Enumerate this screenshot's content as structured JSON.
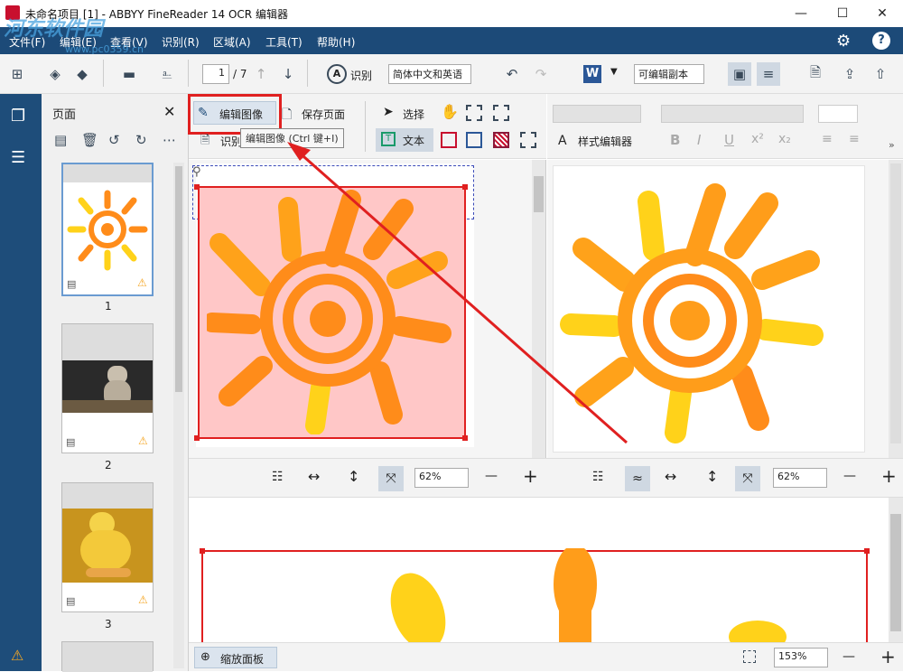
{
  "window": {
    "title": "未命名项目 [1] - ABBYY FineReader 14 OCR 编辑器",
    "minimize": "—",
    "maximize": "☐",
    "close": "✕"
  },
  "watermark": {
    "text": "河东软件园",
    "url": "www.pc0359.cn"
  },
  "menu": {
    "items": [
      "文件(F)",
      "编辑(E)",
      "查看(V)",
      "识别(R)",
      "区域(A)",
      "工具(T)",
      "帮助(H)"
    ],
    "settings_icon": "gear-icon",
    "help_icon": "help-icon"
  },
  "toolbar": {
    "page_current": "1",
    "page_total": "/ 7",
    "recognize_label": "识别",
    "language": "简体中文和英语",
    "output_mode": "可编辑副本"
  },
  "sidebar": {
    "panel_title": "页面",
    "pages": [
      "1",
      "2",
      "3"
    ]
  },
  "edit_toolbar": {
    "edit_image": "编辑图像",
    "save_page": "保存页面",
    "recognize_page": "识别",
    "select": "选择",
    "text": "文本",
    "tooltip": "编辑图像 (Ctrl 键+I)"
  },
  "format_toolbar": {
    "style_editor": "样式编辑器",
    "bold": "B",
    "italic": "I",
    "underline": "U",
    "superscript": "x²",
    "subscript": "x₂"
  },
  "zoom": {
    "image_zoom": "62%",
    "text_zoom": "62%",
    "bottom_zoom": "153%",
    "zoom_panel_label": "缩放面板",
    "minus": "—",
    "plus": "+"
  },
  "colors": {
    "menubar": "#1c4a78",
    "rail": "#1e4d7a",
    "highlight_red": "#e02020",
    "sun_orange": "#ff8c1a",
    "sun_yellow": "#ffd21a"
  }
}
